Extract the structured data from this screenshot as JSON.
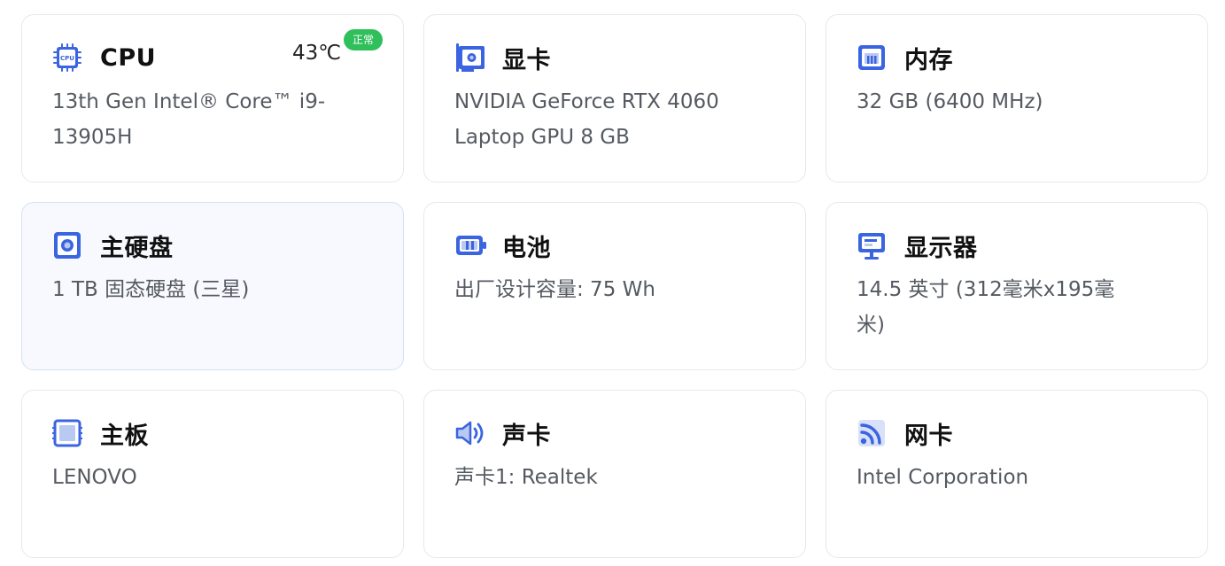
{
  "colors": {
    "accent": "#3a64e0",
    "accent_light": "#b9c9f2",
    "badge_green": "#2fbf5b"
  },
  "cards": [
    {
      "id": "cpu",
      "title": "CPU",
      "value": "13th Gen Intel® Core™ i9-13905H",
      "icon": "cpu-chip-icon",
      "icon_text": "CPU",
      "temperature": "43℃",
      "status": "正常"
    },
    {
      "id": "gpu",
      "title": "显卡",
      "value": "NVIDIA GeForce RTX 4060 Laptop GPU 8 GB",
      "icon": "graphics-card-icon"
    },
    {
      "id": "memory",
      "title": "内存",
      "value": "32 GB (6400 MHz)",
      "icon": "memory-icon"
    },
    {
      "id": "disk",
      "title": "主硬盘",
      "value": "1 TB 固态硬盘 (三星)",
      "icon": "hard-disk-icon"
    },
    {
      "id": "battery",
      "title": "电池",
      "value": "出厂设计容量: 75 Wh",
      "icon": "battery-icon"
    },
    {
      "id": "display",
      "title": "显示器",
      "value": "14.5 英寸 (312毫米x195毫米)",
      "icon": "monitor-icon"
    },
    {
      "id": "motherboard",
      "title": "主板",
      "value": "LENOVO",
      "icon": "motherboard-icon"
    },
    {
      "id": "sound",
      "title": "声卡",
      "value": "声卡1: Realtek",
      "icon": "speaker-icon"
    },
    {
      "id": "network",
      "title": "网卡",
      "value": "Intel Corporation",
      "icon": "wifi-icon"
    }
  ]
}
